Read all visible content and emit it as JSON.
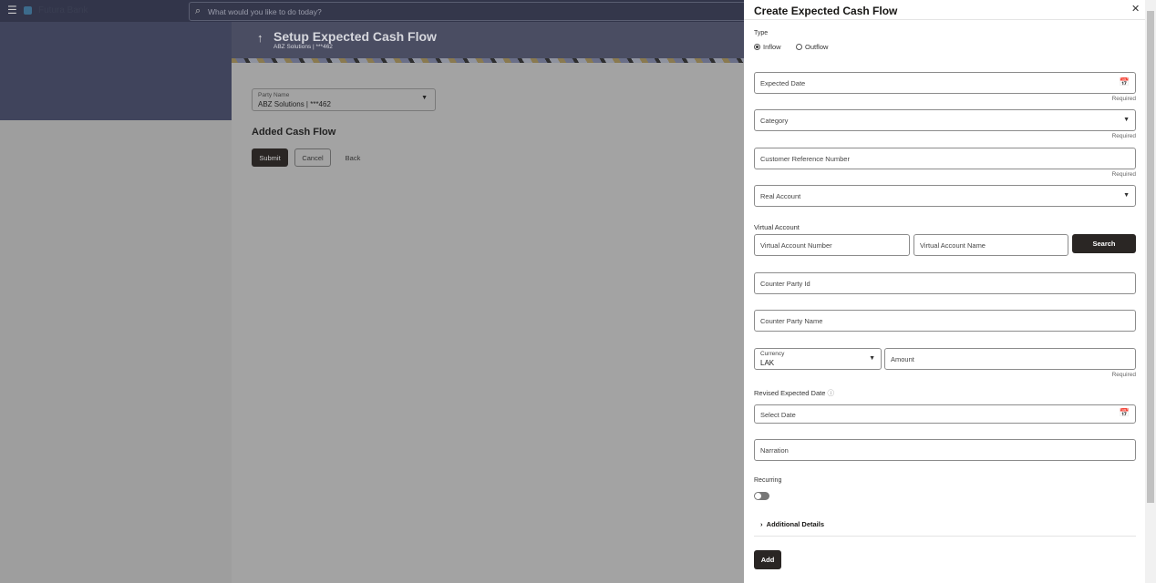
{
  "topbar": {
    "bank_name": "Futura Bank",
    "search_placeholder": "What would you like to do today?"
  },
  "page": {
    "title": "Setup Expected Cash Flow",
    "subtitle": "ABZ Solutions | ***462",
    "party_label": "Party Name",
    "party_value": "ABZ Solutions | ***462",
    "section_title": "Added Cash Flow",
    "submit": "Submit",
    "cancel": "Cancel",
    "back": "Back"
  },
  "panel": {
    "title": "Create Expected Cash Flow",
    "type_label": "Type",
    "inflow": "Inflow",
    "outflow": "Outflow",
    "type_selected": "Inflow",
    "expected_date": "Expected Date",
    "category": "Category",
    "customer_ref": "Customer Reference Number",
    "real_account": "Real Account",
    "required": "Required",
    "virtual_account_label": "Virtual Account",
    "va_number": "Virtual Account Number",
    "va_name": "Virtual Account Name",
    "search": "Search",
    "counter_party_id": "Counter Party Id",
    "counter_party_name": "Counter Party Name",
    "currency_label": "Currency",
    "currency_value": "LAK",
    "amount": "Amount",
    "revised_date_label": "Revised Expected Date",
    "revised_date_placeholder": "Select Date",
    "narration": "Narration",
    "recurring_label": "Recurring",
    "recurring_on": false,
    "additional_details": "Additional Details",
    "add": "Add"
  }
}
